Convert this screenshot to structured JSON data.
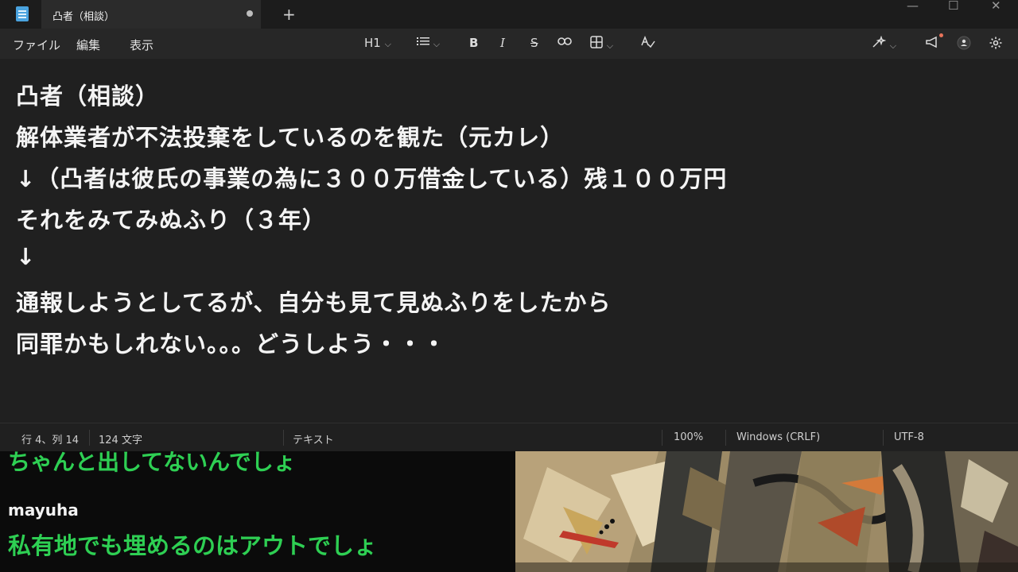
{
  "window": {
    "tab_title": "凸者（相談）",
    "new_tab": "+",
    "minimize": "—",
    "maximize": "☐",
    "close": "✕"
  },
  "menu": {
    "file": "ファイル",
    "edit": "編集",
    "view": "表示"
  },
  "toolbar": {
    "heading": "H1",
    "list_icon": "list-icon",
    "bold": "B",
    "italic": "I",
    "strike": "S",
    "link_icon": "link-icon",
    "table_icon": "table-icon",
    "spell_icon": "spellcheck-icon",
    "copilot_icon": "copilot-icon",
    "feedback_icon": "megaphone-icon",
    "account_icon": "account-icon",
    "settings_icon": "gear-icon"
  },
  "document": {
    "lines": [
      "凸者（相談）",
      "解体業者が不法投棄をしているのを観た（元カレ）",
      "↓（凸者は彼氏の事業の為に３００万借金している）残１００万円",
      "それをみてみぬふり（３年）",
      "↓",
      "通報しようとしてるが、自分も見て見ぬふりをしたから",
      "同罪かもしれない。。。どうしよう・・・"
    ]
  },
  "status": {
    "position": "行 4、列 14",
    "chars": "124 文字",
    "format": "テキスト",
    "zoom": "100%",
    "line_ending": "Windows (CRLF)",
    "encoding": "UTF-8"
  },
  "chat": {
    "prev_message": "ちゃんと出してないんでしょ",
    "username": "mayuha",
    "message": "私有地でも埋めるのはアウトでしょ"
  },
  "colors": {
    "chat_text": "#2ecf53",
    "editor_bg": "#202020"
  }
}
